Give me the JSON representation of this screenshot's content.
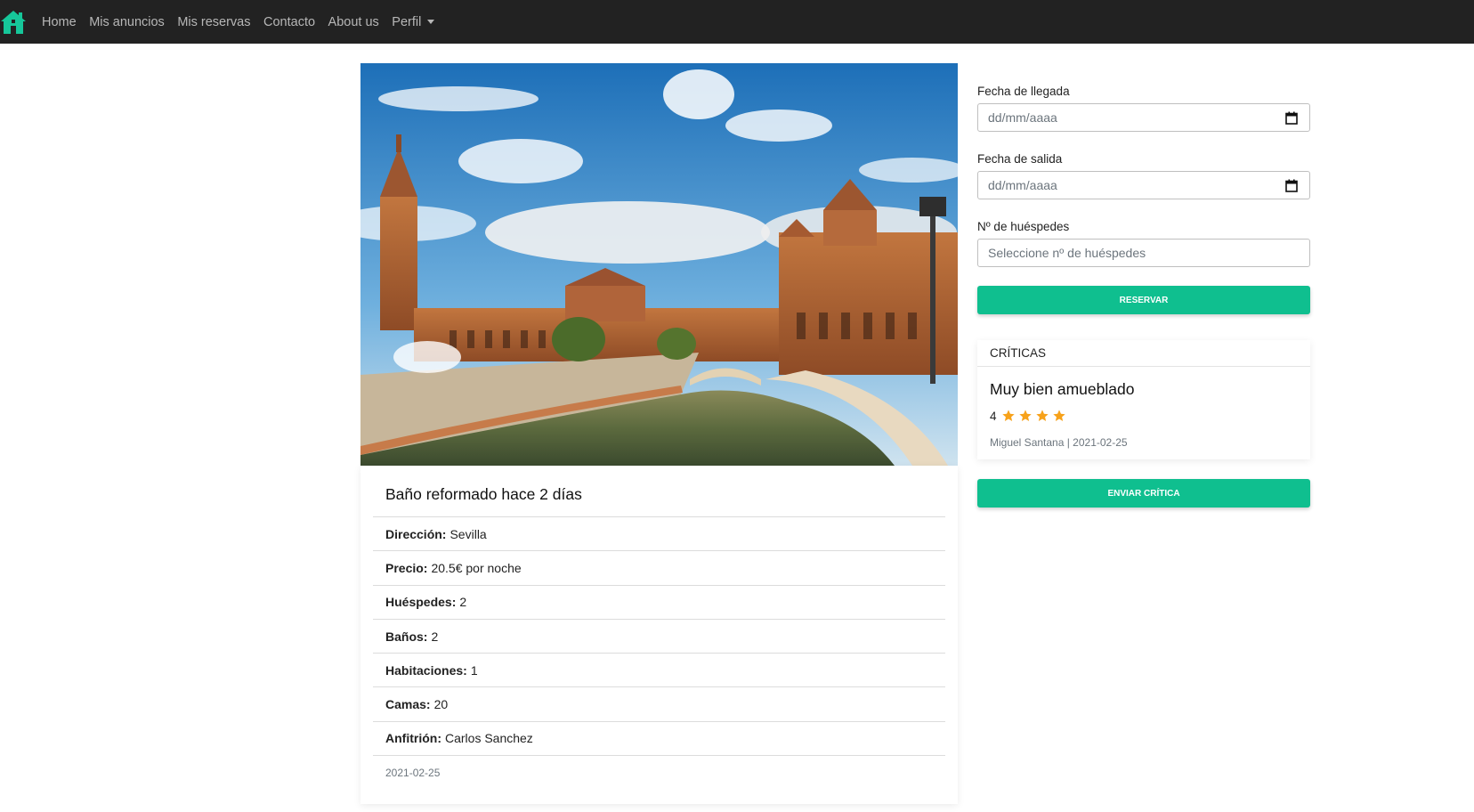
{
  "nav": {
    "brand_icon": "house-icon",
    "items": [
      "Home",
      "Mis anuncios",
      "Mis reservas",
      "Contacto",
      "About us"
    ],
    "profile": "Perfil"
  },
  "listing": {
    "image_alt": "Plaza de España, Sevilla",
    "title": "Baño reformado hace 2 días",
    "details": [
      {
        "label": "Dirección:",
        "value": "Sevilla"
      },
      {
        "label": "Precio:",
        "value": "20.5€ por noche"
      },
      {
        "label": "Huéspedes:",
        "value": "2"
      },
      {
        "label": "Baños:",
        "value": "2"
      },
      {
        "label": "Habitaciones:",
        "value": "1"
      },
      {
        "label": "Camas:",
        "value": "20"
      },
      {
        "label": "Anfitrión:",
        "value": "Carlos Sanchez"
      }
    ],
    "date": "2021-02-25"
  },
  "booking": {
    "arrival_label": "Fecha de llegada",
    "arrival_placeholder": "dd/mm/aaaa",
    "departure_label": "Fecha de salida",
    "departure_placeholder": "dd/mm/aaaa",
    "guests_label": "Nº de huéspedes",
    "guests_placeholder": "Seleccione nº de huéspedes",
    "reserve_button": "RESERVAR"
  },
  "reviews": {
    "header": "CRÍTICAS",
    "items": [
      {
        "title": "Muy bien amueblado",
        "rating": 4,
        "author": "Miguel Santana",
        "date": "2021-02-25",
        "meta": "Miguel Santana | 2021-02-25"
      }
    ],
    "send_button": "ENVIAR CRÍTICA"
  },
  "colors": {
    "accent": "#0fbf8f",
    "navbar": "#222222",
    "star": "#f7a21b"
  }
}
